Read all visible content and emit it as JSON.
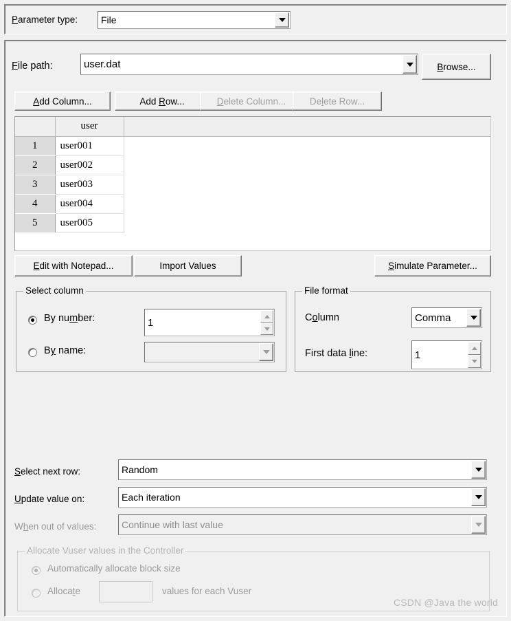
{
  "parameter_type": {
    "label_prefix": "P",
    "label": "arameter type:",
    "value": "File"
  },
  "file_path": {
    "label_prefix": "F",
    "label": "ile path:",
    "value": "user.dat",
    "browse_prefix": "B",
    "browse_label": "rowse..."
  },
  "grid_buttons": [
    {
      "name": "add-column-button",
      "pre": "A",
      "mid": "dd Column...",
      "post": "",
      "enabled": true
    },
    {
      "name": "add-row-button",
      "pre": "",
      "mid": "Add ",
      "under": "R",
      "post": "ow...",
      "enabled": true
    },
    {
      "name": "delete-column-button",
      "pre": "D",
      "mid": "elete Column...",
      "post": "",
      "enabled": false
    },
    {
      "name": "delete-row-button",
      "pre": "",
      "mid": "De",
      "under": "l",
      "post": "ete Row...",
      "enabled": false
    }
  ],
  "grid": {
    "columns": [
      "user"
    ],
    "row_numbers": [
      "1",
      "2",
      "3",
      "4",
      "5"
    ],
    "rows": [
      [
        "user001"
      ],
      [
        "user002"
      ],
      [
        "user003"
      ],
      [
        "user004"
      ],
      [
        "user005"
      ]
    ]
  },
  "table_actions": {
    "edit_notepad_prefix": "E",
    "edit_notepad_label": "dit with Notepad...",
    "import_values_label": "Import Values",
    "simulate_prefix": "S",
    "simulate_label": "imulate Parameter..."
  },
  "select_column": {
    "title": "Select column",
    "by_number": {
      "pre": "By nu",
      "under": "m",
      "post": "ber:",
      "selected": true,
      "value": "1"
    },
    "by_name": {
      "pre": "B",
      "under": "y",
      "post": " name:",
      "selected": false,
      "value": ""
    }
  },
  "file_format": {
    "title": "File format",
    "column": {
      "pre": "C",
      "under": "o",
      "post": "lumn",
      "value": "Comma"
    },
    "first_data_line": {
      "pre": "First data ",
      "under": "l",
      "post": "ine:",
      "value": "1"
    }
  },
  "rows_section": {
    "select_next_row": {
      "under": "S",
      "post": "elect next row:",
      "value": "Random",
      "enabled": true
    },
    "update_value_on": {
      "under": "U",
      "post": "pdate value on:",
      "value": "Each iteration",
      "enabled": true
    },
    "when_out_of_values": {
      "pre": "W",
      "under": "h",
      "post": "en out of values:",
      "value": "Continue with last value",
      "enabled": false
    }
  },
  "allocate_group": {
    "title": "Allocate Vuser values in the Controller",
    "auto": {
      "label": "Automatically allocate block size",
      "selected": true
    },
    "manual": {
      "pre": "Alloca",
      "under": "t",
      "post": "e",
      "value": "",
      "tail": "values for each Vuser",
      "selected": false
    }
  },
  "watermark": "CSDN @Java the world",
  "colors": {
    "face": "#f0f0f0",
    "text": "#000000",
    "disabled_text": "#a0a0a0",
    "field_bg": "#ffffff",
    "row_header_bg": "#dcdcdc",
    "watermark": "#b9b9b9"
  }
}
